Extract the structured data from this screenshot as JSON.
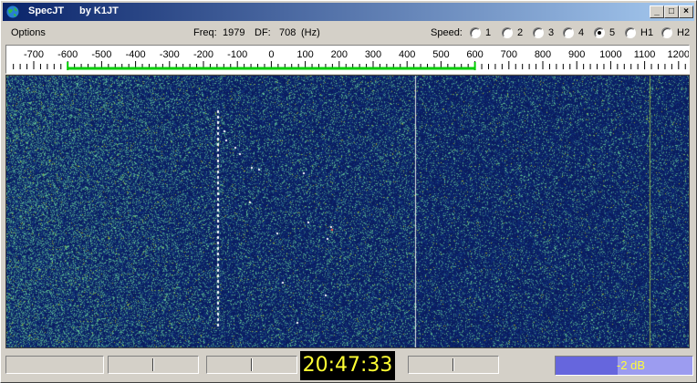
{
  "window": {
    "title": "SpecJT",
    "author": "by K1JT",
    "minimize": "_",
    "maximize": "□",
    "close": "×"
  },
  "menu": {
    "options": "Options"
  },
  "info": {
    "freq_label": "Freq:",
    "freq_value": "1979",
    "df_label": "DF:",
    "df_value": "708",
    "df_unit": "(Hz)"
  },
  "speed": {
    "label": "Speed:",
    "options": [
      "1",
      "2",
      "3",
      "4",
      "5",
      "H1",
      "H2"
    ],
    "selected": "5"
  },
  "scale": {
    "tick_labels": [
      "-700",
      "-600",
      "-500",
      "-400",
      "-300",
      "-200",
      "-100",
      "0",
      "100",
      "200",
      "300",
      "400",
      "500",
      "600",
      "700",
      "800",
      "900",
      "1000",
      "1100",
      "1200"
    ],
    "green_range": [
      "-600",
      "600"
    ]
  },
  "status": {
    "time": "20:47:33",
    "level_text": "-2 dB",
    "level_fraction": 0.45
  },
  "colors": {
    "waterfall_bg": "#0b1f5e",
    "signal_line": "#ffffff",
    "green_band": "#00cc00",
    "clock_text": "#ffff33"
  }
}
